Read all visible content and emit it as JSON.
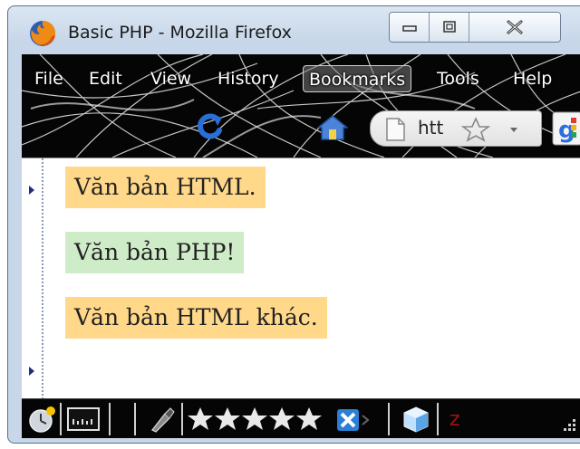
{
  "window": {
    "title": "Basic PHP - Mozilla Firefox",
    "minimize_icon": "minimize-icon",
    "maximize_icon": "maximize-icon",
    "close_icon": "close-icon"
  },
  "menubar": {
    "items": [
      {
        "label": "File"
      },
      {
        "label": "Edit"
      },
      {
        "label": "View"
      },
      {
        "label": "History"
      },
      {
        "label": "Bookmarks",
        "active": true
      },
      {
        "label": "Tools"
      },
      {
        "label": "Help"
      }
    ]
  },
  "navbar": {
    "url_text": "htt",
    "icons": [
      "reload-icon",
      "home-icon",
      "page-icon",
      "bookmark-star-icon",
      "dropdown-arrow-icon",
      "google-icon"
    ]
  },
  "content": {
    "blocks": [
      {
        "text": "Văn bản HTML.",
        "kind": "html"
      },
      {
        "text": "Văn bản PHP!",
        "kind": "php"
      },
      {
        "text": "Văn bản HTML khác.",
        "kind": "html"
      }
    ]
  },
  "statusbar": {
    "z_label": "z",
    "rating_stars": 5,
    "icons": [
      "clock-icon",
      "ruler-icon",
      "eyedropper-icon",
      "rating-stars-icon",
      "xmarks-icon",
      "cube-icon",
      "z-icon",
      "resize-grip-icon"
    ]
  },
  "colors": {
    "html_block": "#ffd889",
    "php_block": "#cfecc8",
    "chrome_bg": "#050505",
    "reload_blue": "#2a6fd6"
  }
}
